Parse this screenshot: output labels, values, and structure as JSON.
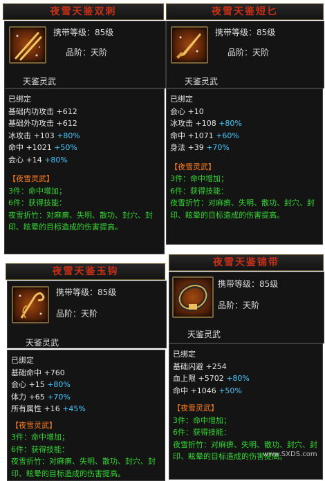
{
  "cards": [
    {
      "title": "夜雪天鉴双刺",
      "level_label": "携带等级：",
      "level": "85级",
      "grade_label": "品阶：",
      "grade": "天阶",
      "category": "天鉴灵武",
      "bound": "已绑定",
      "stats": [
        {
          "name": "基础内功攻击",
          "value": "+612",
          "bonus": ""
        },
        {
          "name": "基础外功攻击",
          "value": "+612",
          "bonus": ""
        },
        {
          "name": "冰攻击",
          "value": "+103",
          "bonus": "+80%"
        },
        {
          "name": "命中",
          "value": "+1021",
          "bonus": "+50%"
        },
        {
          "name": "会心",
          "value": "+14",
          "bonus": "+80%"
        }
      ],
      "set_name": "【夜雪灵武】",
      "set_lines": [
        "3件：命中增加；",
        "6件：获得技能："
      ],
      "skill_desc": "夜雪折竹：对麻痹、失明、散功、封穴、封印、眩晕的目标造成的伤害提高。",
      "icon": "double-dagger-icon"
    },
    {
      "title": "夜雪天鉴短匕",
      "level_label": "携带等级：",
      "level": "85级",
      "grade_label": "品阶：",
      "grade": "天阶",
      "category": "天鉴灵武",
      "bound": "已绑定",
      "stats": [
        {
          "name": "会心",
          "value": "+10",
          "bonus": ""
        },
        {
          "name": "冰攻击",
          "value": "+108",
          "bonus": "+80%"
        },
        {
          "name": "命中",
          "value": "+1071",
          "bonus": "+60%"
        },
        {
          "name": "身法",
          "value": "+39",
          "bonus": "+70%"
        }
      ],
      "set_name": "【夜雪灵武】",
      "set_lines": [
        "3件：命中增加；",
        "6件：获得技能："
      ],
      "skill_desc": "夜雪折竹：对麻痹、失明、散功、封穴、封印、眩晕的目标造成的伤害提高。",
      "icon": "short-dagger-icon"
    },
    {
      "title": "夜雪天鉴玉钩",
      "level_label": "携带等级：",
      "level": "85级",
      "grade_label": "品阶：",
      "grade": "天阶",
      "category": "天鉴灵武",
      "bound": "已绑定",
      "stats": [
        {
          "name": "基础命中",
          "value": "+760",
          "bonus": ""
        },
        {
          "name": "会心",
          "value": "+15",
          "bonus": "+80%"
        },
        {
          "name": "体力",
          "value": "+65",
          "bonus": "+70%"
        },
        {
          "name": "所有属性",
          "value": "+16",
          "bonus": "+45%"
        }
      ],
      "set_name": "【夜雪灵武】",
      "set_lines": [
        "3件：命中增加；",
        "6件：获得技能："
      ],
      "skill_desc": "夜雪折竹：对麻痹、失明、散功、封穴、封印、眩晕的目标造成的伤害提高。",
      "icon": "jade-hook-icon"
    },
    {
      "title": "夜雪天鉴锦带",
      "level_label": "携带等级：",
      "level": "85级",
      "grade_label": "品阶：",
      "grade": "天阶",
      "category": "天鉴灵武",
      "bound": "已绑定",
      "stats": [
        {
          "name": "基础闪避",
          "value": "+254",
          "bonus": ""
        },
        {
          "name": "血上限",
          "value": "+5702",
          "bonus": "+80%"
        },
        {
          "name": "命中",
          "value": "+1046",
          "bonus": "+50%"
        }
      ],
      "set_name": "【夜雪灵武】",
      "set_lines": [
        "3件：命中增加；",
        "6件：获得技能："
      ],
      "skill_desc": "夜雪折竹：对麻痹、失明、散功、封穴、封印、眩晕的目标造成的伤害提高。",
      "icon": "belt-icon"
    }
  ],
  "watermark": "www.SXDS.com"
}
